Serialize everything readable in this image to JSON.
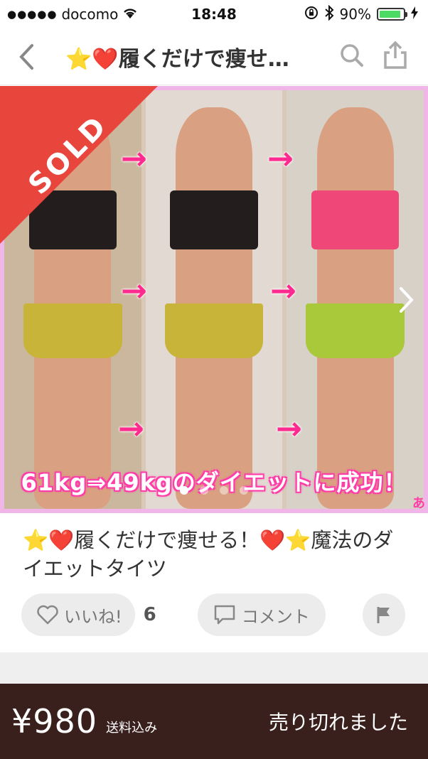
{
  "status_bar": {
    "carrier": "docomo",
    "time": "18:48",
    "battery_pct": "90%",
    "battery_level": 0.9
  },
  "nav": {
    "title": "⭐❤️履くだけで痩せ…"
  },
  "photo": {
    "caption": "61kg⇒49kgのダイエットに成功！",
    "sold_label": "SOLD",
    "watermark": "あ",
    "page_count": 4,
    "active_page": 1
  },
  "item": {
    "title": "⭐❤️履くだけで痩せる！❤️⭐魔法のダイエットタイツ"
  },
  "actions": {
    "like_label": "いいね!",
    "like_count": "6",
    "comment_label": "コメント"
  },
  "bottom_bar": {
    "price": "¥980",
    "shipping": "送料込み",
    "status": "売り切れました"
  },
  "colors": {
    "sold_ribbon": "#e8453c",
    "bottom_bar": "#3a201c",
    "photo_border": "#f0b6e8",
    "caption_glow": "#ff3da8"
  }
}
